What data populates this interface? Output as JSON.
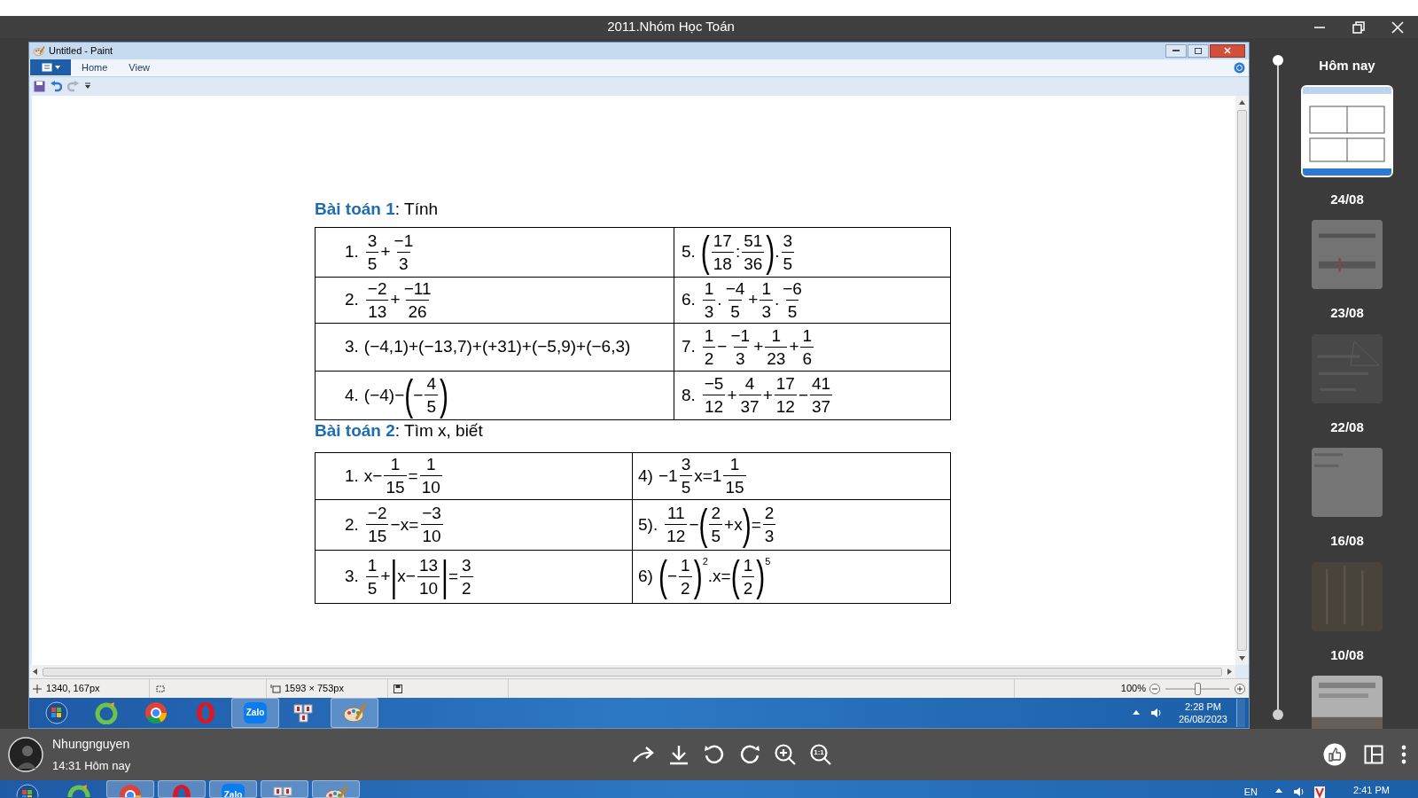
{
  "viewer": {
    "title": "2011.Nhóm Học Toán"
  },
  "paint": {
    "title": "Untitled - Paint",
    "tabs": [
      {
        "label": "Home"
      },
      {
        "label": "View"
      }
    ]
  },
  "document": {
    "sections": [
      {
        "heading": "**Bài toán 1**: Tính",
        "rows": [
          [
            {
              "label": "1.",
              "expr": [
                {
                  "f": [
                    "3",
                    "5"
                  ]
                },
                "+",
                {
                  "f": [
                    "−1",
                    "3"
                  ]
                }
              ]
            },
            {
              "label": "5.",
              "expr": [
                {
                  "big": "("
                },
                {
                  "f": [
                    "17",
                    "18"
                  ]
                },
                ":",
                {
                  "f": [
                    "51",
                    "36"
                  ]
                },
                {
                  "big": ")"
                },
                ".",
                {
                  "f": [
                    "3",
                    "5"
                  ]
                }
              ]
            }
          ],
          [
            {
              "label": "2.",
              "expr": [
                {
                  "f": [
                    "−2",
                    "13"
                  ]
                },
                "+",
                {
                  "f": [
                    "−11",
                    "26"
                  ]
                }
              ]
            },
            {
              "label": "6.",
              "expr": [
                {
                  "f": [
                    "1",
                    "3"
                  ]
                },
                ".",
                {
                  "f": [
                    "−4",
                    "5"
                  ]
                },
                "+",
                {
                  "f": [
                    "1",
                    "3"
                  ]
                },
                ".",
                {
                  "f": [
                    "−6",
                    "5"
                  ]
                }
              ]
            }
          ],
          [
            {
              "label": "3.",
              "expr": [
                "(−4,1)+(−13,7)+(+31)+(−5,9)+(−6,3)"
              ]
            },
            {
              "label": "7.",
              "expr": [
                {
                  "f": [
                    "1",
                    "2"
                  ]
                },
                "−",
                {
                  "f": [
                    "−1",
                    "3"
                  ]
                },
                "+",
                {
                  "f": [
                    "1",
                    "23"
                  ]
                },
                "+",
                {
                  "f": [
                    "1",
                    "6"
                  ]
                }
              ]
            }
          ],
          [
            {
              "label": "4.",
              "expr": [
                "(−4)−",
                {
                  "big": "("
                },
                "−",
                {
                  "f": [
                    "4",
                    "5"
                  ]
                },
                {
                  "big": ")"
                }
              ]
            },
            {
              "label": "8.",
              "expr": [
                {
                  "f": [
                    "−5",
                    "12"
                  ]
                },
                "+",
                {
                  "f": [
                    "4",
                    "37"
                  ]
                },
                "+",
                {
                  "f": [
                    "17",
                    "12"
                  ]
                },
                "−",
                {
                  "f": [
                    "41",
                    "37"
                  ]
                }
              ]
            }
          ]
        ]
      },
      {
        "heading": "**Bài toán 2**: Tìm x, biết",
        "rows": [
          [
            {
              "label": "1.",
              "expr": [
                "x−",
                {
                  "f": [
                    "1",
                    "15"
                  ]
                },
                "=",
                {
                  "f": [
                    "1",
                    "10"
                  ]
                }
              ]
            },
            {
              "label": "4)",
              "expr": [
                "−1",
                {
                  "f": [
                    "3",
                    "5"
                  ]
                },
                "x=1",
                {
                  "f": [
                    "1",
                    "15"
                  ]
                }
              ]
            }
          ],
          [
            {
              "label": "2.",
              "expr": [
                {
                  "f": [
                    "−2",
                    "15"
                  ]
                },
                "−x=",
                {
                  "f": [
                    "−3",
                    "10"
                  ]
                }
              ]
            },
            {
              "label": "5).",
              "expr": [
                {
                  "f": [
                    "11",
                    "12"
                  ]
                },
                "−",
                {
                  "big": "("
                },
                {
                  "f": [
                    "2",
                    "5"
                  ]
                },
                "+x",
                {
                  "big": ")"
                },
                "=",
                {
                  "f": [
                    "2",
                    "3"
                  ]
                }
              ]
            }
          ],
          [
            {
              "label": "3.",
              "expr": [
                {
                  "f": [
                    "1",
                    "5"
                  ]
                },
                "+",
                {
                  "big": "|"
                },
                "x−",
                {
                  "f": [
                    "13",
                    "10"
                  ]
                },
                {
                  "big": "|"
                },
                "=",
                {
                  "f": [
                    "3",
                    "2"
                  ]
                }
              ]
            },
            {
              "label": "6)",
              "expr": [
                {
                  "big": "("
                },
                "−",
                {
                  "f": [
                    "1",
                    "2"
                  ]
                },
                {
                  "big": ")"
                },
                {
                  "sup": "2"
                },
                ".x=",
                {
                  "big": "("
                },
                {
                  "f": [
                    "1",
                    "2"
                  ]
                },
                {
                  "big": ")"
                },
                {
                  "sup": "5"
                }
              ]
            }
          ]
        ]
      }
    ]
  },
  "status_bar": {
    "cursor": "1340, 167px",
    "size": "1593 × 753px",
    "zoom": "100%",
    "zoom_slider": {
      "level": 0.5
    }
  },
  "taskbar": {
    "apps": [
      {
        "kind": "start",
        "active": false
      },
      {
        "kind": "ring",
        "active": false
      },
      {
        "kind": "chrome",
        "active": false
      },
      {
        "kind": "opera",
        "active": false
      },
      {
        "kind": "zalo",
        "label": "Zalo",
        "active": true
      },
      {
        "kind": "unikey",
        "active": false
      },
      {
        "kind": "paint",
        "active": true
      }
    ],
    "time": "2:28 PM",
    "date": "26/08/2023"
  },
  "timeline": [
    {
      "label": "Hôm nay",
      "thumbnail": {
        "selected": true
      }
    },
    {
      "label": "24/08",
      "thumbnail": {
        "selected": false
      }
    },
    {
      "label": "23/08",
      "thumbnail": {
        "selected": false
      }
    },
    {
      "label": "22/08",
      "thumbnail": {
        "selected": false
      }
    },
    {
      "label": "16/08",
      "thumbnail": {
        "selected": false
      }
    },
    {
      "label": "10/08",
      "thumbnail": {
        "selected": false
      }
    }
  ],
  "sender": {
    "name": "Nhungnguyen",
    "time": "14:31 Hôm nay"
  },
  "toolbar": {
    "actual_size": "1:1"
  },
  "os_taskbar": {
    "apps": [
      {
        "kind": "start",
        "active": false
      },
      {
        "kind": "ring",
        "active": false
      },
      {
        "kind": "chrome",
        "active": true
      },
      {
        "kind": "opera",
        "active": true
      },
      {
        "kind": "zalo",
        "label": "Zalo",
        "active": true
      },
      {
        "kind": "unikey",
        "active": true
      },
      {
        "kind": "paint",
        "active": true
      }
    ],
    "language": "EN",
    "time": "2:41 PM"
  }
}
